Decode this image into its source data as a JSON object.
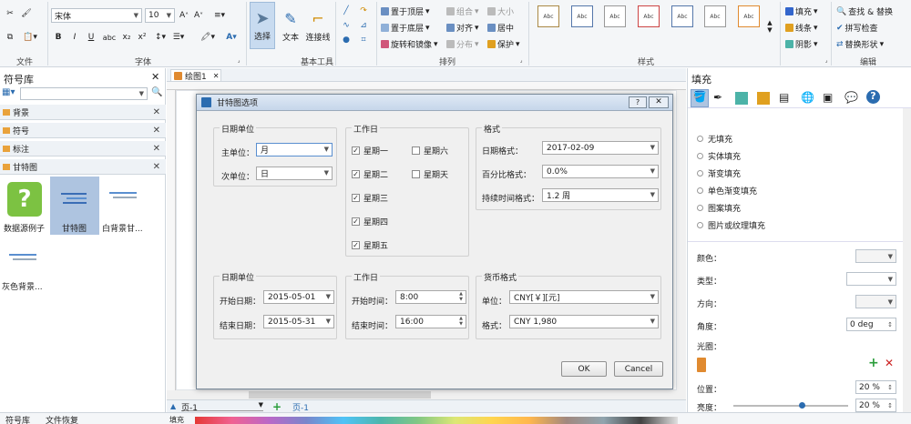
{
  "ribbon": {
    "groups": {
      "file": "文件",
      "font": "字体",
      "tools": "基本工具",
      "arrange": "排列",
      "style": "样式",
      "edit": "编辑"
    },
    "font_name": "宋体",
    "font_size": "10",
    "tools": {
      "select": "选择",
      "text": "文本",
      "connector": "连接线"
    },
    "arrange": {
      "bring_front": "置于顶层",
      "send_back": "置于底层",
      "rotate": "旋转和镜像",
      "group": "组合",
      "align": "对齐",
      "distribute": "分布",
      "size": "大小",
      "center": "居中",
      "protect": "保护"
    },
    "style_boxes": [
      "Abc",
      "Abc",
      "Abc",
      "Abc",
      "Abc",
      "Abc",
      "Abc"
    ],
    "fill_btns": {
      "fill": "填充",
      "line": "线条",
      "shadow": "阴影"
    },
    "edit_btns": {
      "find": "查找 & 替换",
      "spell": "拼写检查",
      "replace": "替换形状"
    }
  },
  "left_panel": {
    "title": "符号库",
    "libraries": [
      "背景",
      "符号",
      "标注",
      "甘特图"
    ],
    "thumbs": [
      "数据源例子",
      "甘特图",
      "白背景甘...",
      "灰色背景..."
    ]
  },
  "tab": {
    "label": "绘图1"
  },
  "right_panel": {
    "title": "填充",
    "options": [
      "无填充",
      "实体填充",
      "渐变填充",
      "单色渐变填充",
      "图案填充",
      "图片或纹理填充"
    ],
    "props": {
      "color": "颜色：",
      "type": "类型：",
      "direction": "方向：",
      "angle": "角度：",
      "angle_val": "0 deg",
      "aperture": "光圈：",
      "position": "位置：",
      "position_val": "20 %",
      "brightness": "亮度：",
      "brightness_val": "20 %"
    }
  },
  "dialog": {
    "title": "甘特图选项",
    "date_unit": {
      "legend": "日期单位",
      "major_label": "主单位：",
      "major": "月",
      "minor_label": "次单位：",
      "minor": "日"
    },
    "workdays": {
      "legend": "工作日",
      "days": [
        {
          "name": "星期一",
          "checked": true
        },
        {
          "name": "星期二",
          "checked": true
        },
        {
          "name": "星期三",
          "checked": true
        },
        {
          "name": "星期四",
          "checked": true
        },
        {
          "name": "星期五",
          "checked": true
        },
        {
          "name": "星期六",
          "checked": false
        },
        {
          "name": "星期天",
          "checked": false
        }
      ]
    },
    "format": {
      "legend": "格式",
      "date_label": "日期格式：",
      "date": "2017-02-09",
      "pct_label": "百分比格式：",
      "pct": "0.0%",
      "dur_label": "持续时间格式：",
      "dur": "1.2 周"
    },
    "range": {
      "legend": "日期单位",
      "start_label": "开始日期：",
      "start": "2015-05-01",
      "end_label": "结束日期：",
      "end": "2015-05-31"
    },
    "worktime": {
      "legend": "工作日",
      "start_label": "开始时间：",
      "start": "8:00",
      "end_label": "结束时间：",
      "end": "16:00"
    },
    "currency": {
      "legend": "货币格式",
      "unit_label": "单位：",
      "unit": "CNY[￥][元]",
      "fmt_label": "格式：",
      "fmt": "CNY 1,980"
    },
    "ok": "OK",
    "cancel": "Cancel"
  },
  "pages": {
    "page_select": "页-1",
    "page_tab": "页-1"
  },
  "status": {
    "left": "符号库",
    "right": "文件恢复",
    "fill_label": "填充"
  },
  "colors": {
    "accent": "#2b6cb0",
    "ribbon_bg": "#f4f6f8",
    "selection": "#aec4e0"
  }
}
